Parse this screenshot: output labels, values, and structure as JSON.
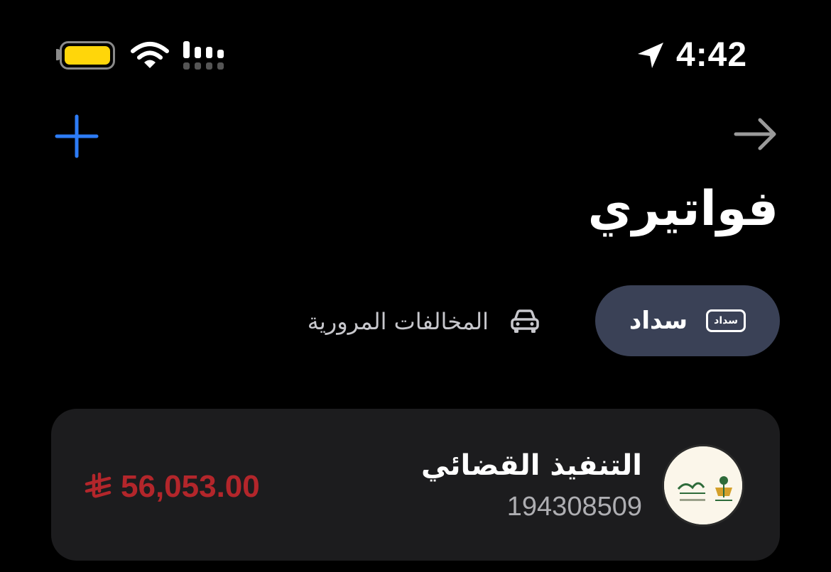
{
  "status_bar": {
    "time": "4:42",
    "battery_level": 1.0,
    "battery_color": "#FFD60A"
  },
  "nav": {
    "title": "فواتيري"
  },
  "tabs": [
    {
      "label": "سداد",
      "icon_label": "سداد",
      "selected": true
    },
    {
      "label": "المخالفات المرورية",
      "selected": false
    }
  ],
  "bills": [
    {
      "name": "التنفيذ القضائي",
      "number": "194308509",
      "amount": "56,053.00",
      "amount_color": "#B3262B",
      "logo": "ministry-of-justice-logo"
    }
  ],
  "colors": {
    "accent": "#2D7CF6",
    "tab_selected_bg": "#3A4156",
    "card_bg": "#1C1C1E"
  }
}
